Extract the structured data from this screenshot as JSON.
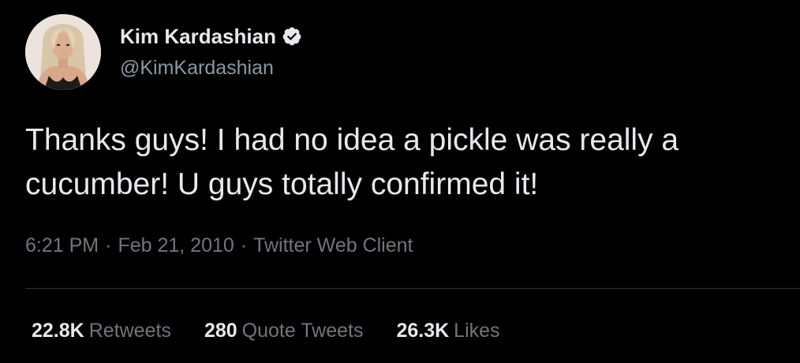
{
  "author": {
    "display_name": "Kim Kardashian",
    "handle": "@KimKardashian",
    "verified": true,
    "verified_icon": "verified-badge-icon"
  },
  "tweet": {
    "text": "Thanks guys! I had no idea a pickle was really a cucumber! U guys totally confirmed it!"
  },
  "meta": {
    "time": "6:21 PM",
    "separator": "·",
    "date": "Feb 21, 2010",
    "client": "Twitter Web Client"
  },
  "stats": [
    {
      "value": "22.8K",
      "label": "Retweets"
    },
    {
      "value": "280",
      "label": "Quote Tweets"
    },
    {
      "value": "26.3K",
      "label": "Likes"
    }
  ],
  "colors": {
    "background": "#000000",
    "text_primary": "#e7e9ea",
    "text_secondary": "#71767b",
    "divider": "#2f3336"
  }
}
